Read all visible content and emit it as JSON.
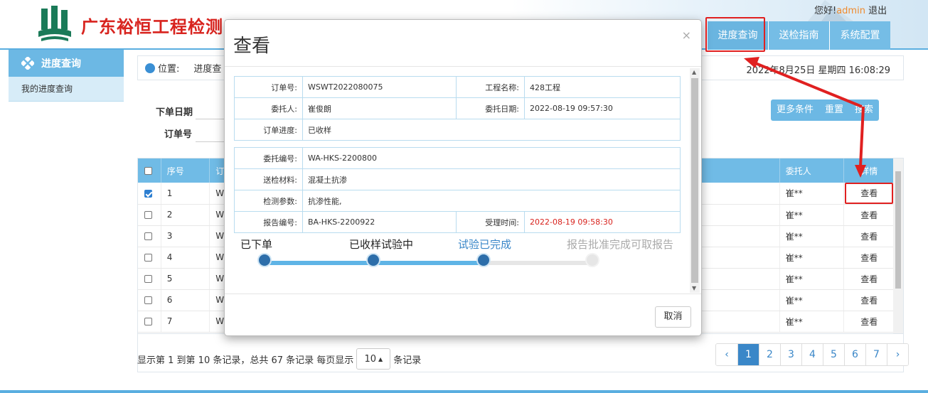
{
  "header": {
    "brand": "广东裕恒工程检测",
    "greeting": "您好!",
    "username": "admin",
    "logout": "退出",
    "nav": [
      "进度查询",
      "送检指南",
      "系统配置"
    ]
  },
  "sidebar": {
    "title": "进度查询",
    "items": [
      "我的进度查询"
    ]
  },
  "breadcrumb": {
    "label": "位置:",
    "path": "进度查",
    "datetime": "2022年8月25日 星期四 16:08:29"
  },
  "search": {
    "order_date_label": "下单日期",
    "order_no_label": "订单号",
    "buttons": [
      "更多条件",
      "重置",
      "搜索"
    ]
  },
  "table": {
    "headers": [
      "序号",
      "订",
      "委托人",
      "详情"
    ],
    "rows": [
      {
        "seq": "1",
        "code": "W",
        "client": "崔**",
        "action": "查看",
        "checked": true
      },
      {
        "seq": "2",
        "code": "W",
        "client": "崔**",
        "action": "查看",
        "checked": false
      },
      {
        "seq": "3",
        "code": "W",
        "client": "崔**",
        "action": "查看",
        "checked": false
      },
      {
        "seq": "4",
        "code": "W",
        "client": "崔**",
        "action": "查看",
        "checked": false
      },
      {
        "seq": "5",
        "code": "W",
        "client": "崔**",
        "action": "查看",
        "checked": false
      },
      {
        "seq": "6",
        "code": "W",
        "client": "崔**",
        "action": "查看",
        "checked": false
      },
      {
        "seq": "7",
        "code": "W",
        "client": "崔**",
        "action": "查看",
        "checked": false
      }
    ]
  },
  "footer": {
    "summary": "显示第 1 到第 10 条记录，总共 67 条记录 每页显示",
    "page_size": "10",
    "suffix": "条记录",
    "pages": [
      "‹",
      "1",
      "2",
      "3",
      "4",
      "5",
      "6",
      "7",
      "›"
    ],
    "current_page": "1"
  },
  "modal": {
    "title": "查看",
    "close": "×",
    "order_info": {
      "order_no_label": "订单号:",
      "order_no": "WSWT2022080075",
      "project_label": "工程名称:",
      "project": "428工程",
      "client_label": "委托人:",
      "client": "崔俊朗",
      "date_label": "委托日期:",
      "date": "2022-08-19 09:57:30",
      "progress_label": "订单进度:",
      "progress": "已收样"
    },
    "sample_info": {
      "commission_label": "委托编号:",
      "commission": "WA-HKS-2200800",
      "material_label": "送检材料:",
      "material": "混凝土抗渗",
      "param_label": "检测参数:",
      "param": "抗渗性能,",
      "report_label": "报告编号:",
      "report": "BA-HKS-2200922",
      "accept_label": "受理时间:",
      "accept": "2022-08-19 09:58:30"
    },
    "steps": [
      "已下单",
      "已收样试验中",
      "试验已完成",
      "报告批准完成可取报告"
    ],
    "progress_fraction": 0.67,
    "cancel": "取消"
  },
  "colors": {
    "accent": "#6cb8e4",
    "brand_red": "#d8231e",
    "annotation": "#e02020"
  }
}
